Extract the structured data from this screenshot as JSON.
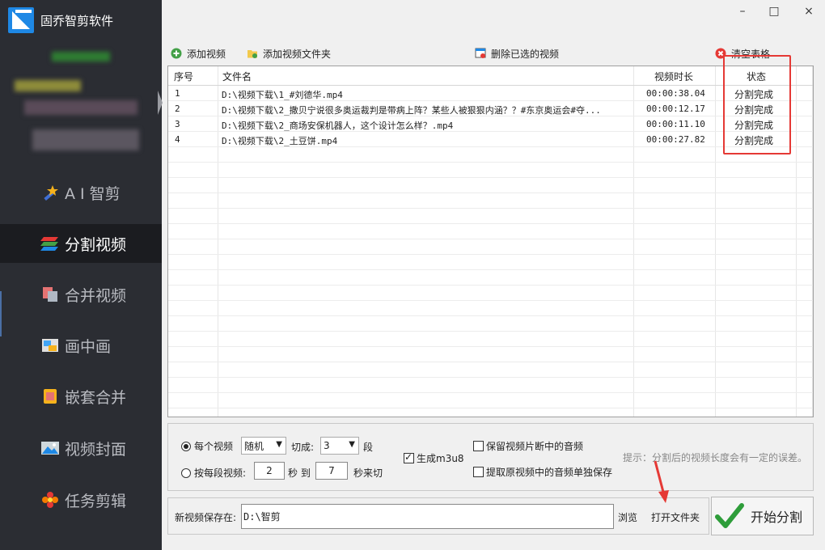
{
  "app": {
    "title": "固乔智剪软件"
  },
  "window": {
    "minimize": "–",
    "maximize": "□",
    "close": "×"
  },
  "sidebar": {
    "items": [
      {
        "label": "A I 智剪",
        "icon": "ai-wand-icon"
      },
      {
        "label": "分割视频",
        "icon": "split-video-icon",
        "active": true
      },
      {
        "label": "合并视频",
        "icon": "merge-video-icon"
      },
      {
        "label": "画中画",
        "icon": "picture-in-picture-icon"
      },
      {
        "label": "嵌套合并",
        "icon": "nest-merge-icon"
      },
      {
        "label": "视频封面",
        "icon": "video-cover-icon"
      },
      {
        "label": "任务剪辑",
        "icon": "task-edit-icon"
      }
    ]
  },
  "toolbar": {
    "add_video": "添加视频",
    "add_folder": "添加视频文件夹",
    "delete_selected": "删除已选的视频",
    "clear_table": "清空表格"
  },
  "table": {
    "columns": [
      "序号",
      "文件名",
      "视频时长",
      "状态"
    ],
    "rows": [
      {
        "index": "1",
        "filename": "D:\\视频下载\\1_#刘德华.mp4",
        "duration": "00:00:38.04",
        "status": "分割完成"
      },
      {
        "index": "2",
        "filename": "D:\\视频下载\\2_撒贝宁说很多奥运裁判是带病上阵？某些人被狠狠内涵？？#东京奥运会#夺...",
        "duration": "00:00:12.17",
        "status": "分割完成"
      },
      {
        "index": "3",
        "filename": "D:\\视频下载\\2_商场安保机器人，这个设计怎么样？.mp4",
        "duration": "00:00:11.10",
        "status": "分割完成"
      },
      {
        "index": "4",
        "filename": "D:\\视频下载\\2_土豆饼.mp4",
        "duration": "00:00:27.82",
        "status": "分割完成"
      }
    ]
  },
  "options": {
    "per_video_label": "每个视频",
    "mode_value": "随机",
    "cut_into_label": "切成:",
    "segments_value": "3",
    "segments_unit": "段",
    "per_segment_label": "按每段视频:",
    "from_value": "2",
    "sec_label": "秒 到",
    "to_value": "7",
    "sec_cut_label": "秒来切",
    "gen_m3u8": "生成m3u8",
    "keep_audio": "保留视频片断中的音频",
    "extract_audio": "提取原视频中的音频单独保存",
    "hint": "提示：分割后的视频长度会有一定的误差。"
  },
  "save": {
    "label": "新视频保存在:",
    "path": "D:\\智剪",
    "browse": "浏览",
    "open_folder": "打开文件夹",
    "start": "开始分割"
  },
  "colors": {
    "sidebar_bg": "#2b2d33",
    "highlight_red": "#e53935",
    "start_check": "#2e9d3a"
  }
}
